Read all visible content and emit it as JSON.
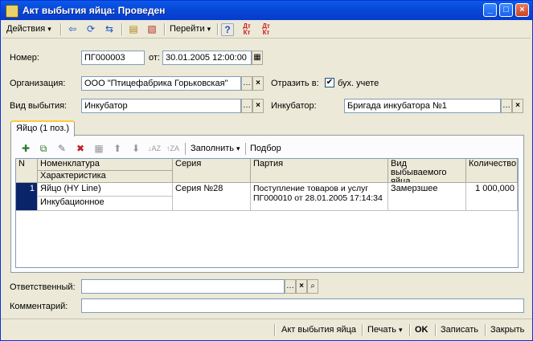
{
  "window": {
    "title": "Акт выбытия яйца: Проведен"
  },
  "toolbar": {
    "actions_label": "Действия",
    "goto_label": "Перейти",
    "help_label": "?",
    "dt_kt_label": "Дт Кт",
    "dt_kt_n_label": "Дт Кт"
  },
  "form": {
    "number_label": "Номер:",
    "number_value": "ПГ000003",
    "date_label": "от:",
    "date_value": "30.01.2005 12:00:00",
    "org_label": "Организация:",
    "org_value": "ООО \"Птицефабрика Горьковская\"",
    "reflect_label": "Отразить в:",
    "reflect_option_label": "бух. учете",
    "reflect_checked": true,
    "type_label": "Вид выбытия:",
    "type_value": "Инкубатор",
    "incubator_label": "Инкубатор:",
    "incubator_value": "Бригада инкубатора №1"
  },
  "tab": {
    "label": "Яйцо (1 поз.)"
  },
  "grid_toolbar": {
    "fill_label": "Заполнить",
    "select_label": "Подбор"
  },
  "grid": {
    "headers": {
      "n": "N",
      "nomenclature": "Номенклатура",
      "characteristic": "Характеристика",
      "series": "Серия",
      "batch": "Партия",
      "disposal_type": "Вид выбываемого яйца",
      "quantity": "Количество"
    },
    "rows": [
      {
        "n": "1",
        "nomenclature": "Яйцо (HY Line)",
        "characteristic": "Инкубационное",
        "series": "Серия №28",
        "batch": "Поступление товаров и услуг ПГ000010 от 28.01.2005 17:14:34",
        "disposal_type": "Замерзшее",
        "quantity": "1 000,000"
      }
    ]
  },
  "footer": {
    "responsible_label": "Ответственный:",
    "responsible_value": "",
    "comment_label": "Комментарий:",
    "comment_value": ""
  },
  "bottom": {
    "report_label": "Акт выбытия яйца",
    "print_label": "Печать",
    "ok_label": "OK",
    "save_label": "Записать",
    "close_label": "Закрыть"
  },
  "colors": {
    "title_bar": "#0848d8",
    "row_marker": "#0a246a",
    "tab_accent": "#ffc83c"
  }
}
